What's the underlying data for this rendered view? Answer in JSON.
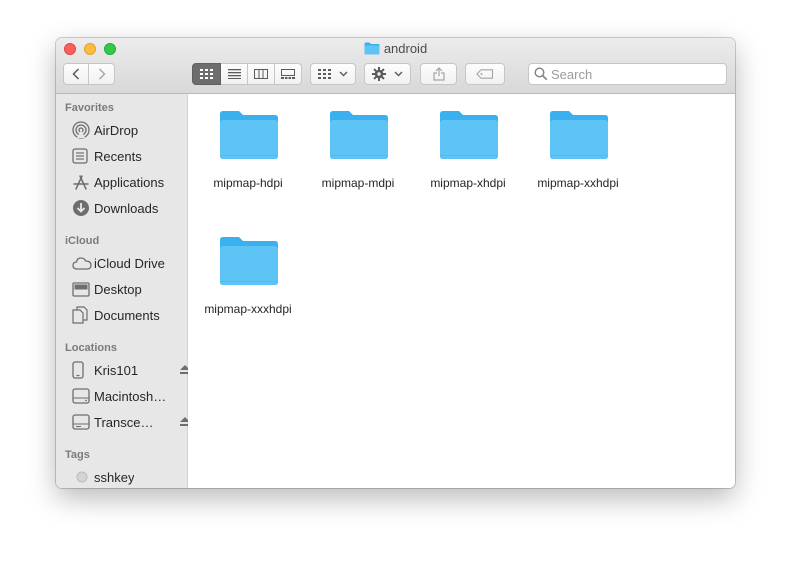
{
  "window": {
    "title": "android",
    "title_icon": "folder-icon"
  },
  "toolbar": {
    "back_icon": "chevron-left-icon",
    "forward_icon": "chevron-right-icon",
    "views": [
      "icon-view-icon",
      "list-view-icon",
      "column-view-icon",
      "gallery-view-icon"
    ],
    "active_view": "icon",
    "group_icon": "group-by-icon",
    "action_icon": "gear-icon",
    "share_icon": "share-icon",
    "tag_icon": "tag-icon"
  },
  "search": {
    "placeholder": "Search",
    "value": ""
  },
  "sidebar": {
    "favorites": {
      "header": "Favorites",
      "items": [
        {
          "label": "AirDrop",
          "icon": "airdrop-icon"
        },
        {
          "label": "Recents",
          "icon": "recents-icon"
        },
        {
          "label": "Applications",
          "icon": "applications-icon"
        },
        {
          "label": "Downloads",
          "icon": "downloads-icon"
        }
      ]
    },
    "icloud": {
      "header": "iCloud",
      "items": [
        {
          "label": "iCloud Drive",
          "icon": "cloud-icon"
        },
        {
          "label": "Desktop",
          "icon": "desktop-icon"
        },
        {
          "label": "Documents",
          "icon": "documents-icon"
        }
      ]
    },
    "locations": {
      "header": "Locations",
      "items": [
        {
          "label": "Kris101",
          "icon": "iphone-icon",
          "ejectable": true
        },
        {
          "label": "Macintosh…",
          "icon": "hard-drive-icon",
          "ejectable": false
        },
        {
          "label": "Transce…",
          "icon": "external-drive-icon",
          "ejectable": true
        }
      ]
    },
    "tags": {
      "header": "Tags",
      "items": [
        {
          "label": "sshkey",
          "icon": "tag-dot-icon",
          "color": "#d4d4d4"
        }
      ]
    }
  },
  "content": {
    "folders": [
      {
        "name": "mipmap-hdpi"
      },
      {
        "name": "mipmap-mdpi"
      },
      {
        "name": "mipmap-xhdpi"
      },
      {
        "name": "mipmap-xxhdpi"
      },
      {
        "name": "mipmap-xxxhdpi"
      }
    ]
  },
  "colors": {
    "folder_front": "#5ec4f6",
    "folder_back": "#3ab0ee",
    "sidebar_bg": "#e7e7e7",
    "close": "#fc605b",
    "minimize": "#fdbc40",
    "maximize": "#34c84a"
  }
}
